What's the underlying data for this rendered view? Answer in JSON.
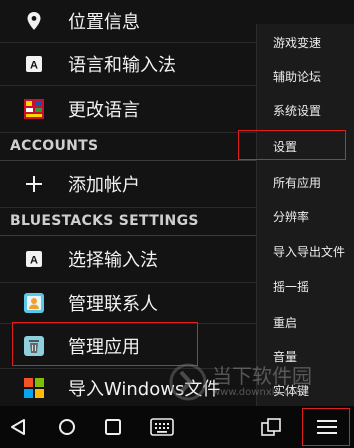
{
  "settings": {
    "rows_top": [
      {
        "label": "位置信息",
        "icon": "location-pin-icon"
      },
      {
        "label": "语言和输入法",
        "icon": "keyboard-a-icon"
      },
      {
        "label": "更改语言",
        "icon": "language-flag-icon"
      }
    ],
    "accounts_header": "ACCOUNTS",
    "add_account": {
      "label": "添加帐户",
      "icon": "plus-icon"
    },
    "bluestacks_header": "BLUESTACKS SETTINGS",
    "rows_bottom": [
      {
        "label": "选择输入法",
        "icon": "keyboard-a-icon"
      },
      {
        "label": "管理联系人",
        "icon": "contacts-icon"
      },
      {
        "label": "管理应用",
        "icon": "trash-app-icon"
      },
      {
        "label": "导入Windows文件",
        "icon": "windows-logo-icon"
      }
    ]
  },
  "overflow_menu": {
    "items": [
      "游戏变速",
      "辅助论坛",
      "系统设置",
      "设置",
      "所有应用",
      "分辨率",
      "导入导出文件",
      "摇一摇",
      "重启",
      "音量",
      "实体键"
    ]
  },
  "watermark": {
    "text": "当下软件园",
    "url_text": "www.downxia.com"
  },
  "colors": {
    "highlight": "#e02020",
    "background": "#131313",
    "menu_bg": "#1b1b1b"
  }
}
